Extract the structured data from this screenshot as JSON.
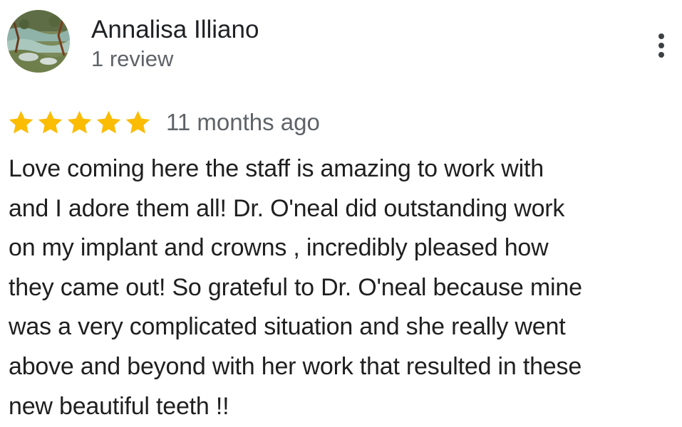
{
  "reviewer": {
    "name": "Annalisa Illiano",
    "review_count": "1 review",
    "avatar_icon": "landscape-avatar-icon"
  },
  "menu": {
    "icon": "more-vert-icon"
  },
  "rating": {
    "stars": 5,
    "max_stars": 5,
    "star_color": "#fbbc04",
    "time": "11 months ago"
  },
  "review": {
    "text": "Love coming here the staff is amazing to work with\nand I adore them all! Dr. O'neal did outstanding work\non my implant and crowns , incredibly pleased how\nthey came out! So grateful to Dr. O'neal because mine\nwas a very complicated situation and she really went\nabove and beyond with her work that resulted in these\nnew beautiful teeth  !!"
  }
}
